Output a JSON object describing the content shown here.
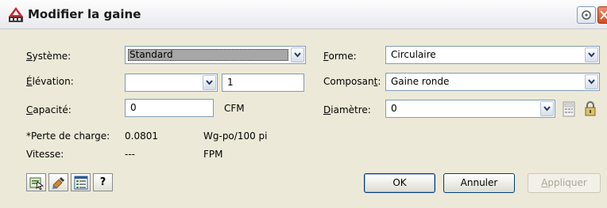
{
  "window": {
    "title": "Modifier la gaine"
  },
  "left": {
    "systeme_label_pre": "S",
    "systeme_label_rest": "ystème:",
    "systeme_value": "Standard",
    "elevation_label_pre": "É",
    "elevation_label_rest": "lévation:",
    "elevation_combo_value": "",
    "elevation_value": "1",
    "capacite_label_pre": "C",
    "capacite_label_rest": "apacité:",
    "capacite_value": "0",
    "capacite_unit": "CFM",
    "perte_label": "*Perte de charge:",
    "perte_value": "0.0801",
    "perte_unit": "Wg-po/100 pi",
    "vitesse_label": "Vitesse:",
    "vitesse_value": "---",
    "vitesse_unit": "FPM"
  },
  "right": {
    "forme_label_pre": "F",
    "forme_label_rest": "orme:",
    "forme_value": "Circulaire",
    "composant_label_pre": "Composan",
    "composant_label_u": "t",
    "composant_label_post": ":",
    "composant_value": "Gaine ronde",
    "diametre_label_pre": "D",
    "diametre_label_rest": "iamètre:",
    "diametre_value": "0"
  },
  "buttons": {
    "ok": "OK",
    "annuler": "Annuler",
    "appliquer_pre": "A",
    "appliquer_rest": "ppliquer"
  },
  "toolbar_icons": [
    "select-objects-icon",
    "match-properties-icon",
    "properties-icon",
    "help-icon"
  ],
  "help_glyph": "?",
  "colors": {
    "title_bar": "#e9e9ee",
    "dialog_bg": "#ece9d8",
    "close_button": "#d24a21",
    "selection_gray": "#a7a7a7"
  }
}
